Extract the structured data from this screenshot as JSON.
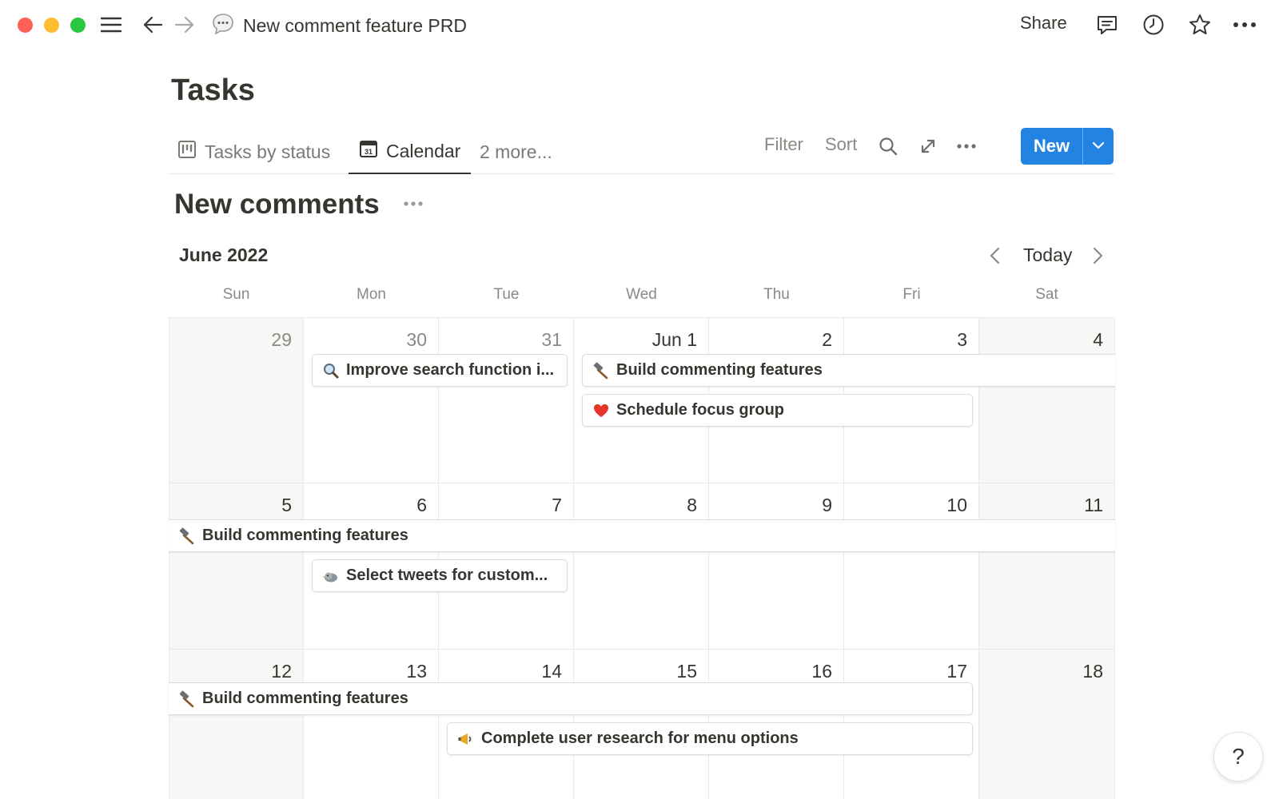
{
  "topbar": {
    "breadcrumb_title": "New comment feature PRD",
    "breadcrumb_icon": "speech-bubble-icon",
    "share_label": "Share"
  },
  "page": {
    "title": "Tasks"
  },
  "views": {
    "tabs": [
      {
        "label": "Tasks by status",
        "icon": "board-icon",
        "active": false
      },
      {
        "label": "Calendar",
        "icon": "calendar-icon",
        "active": true
      },
      {
        "label": "2 more...",
        "active": false
      }
    ],
    "filter_label": "Filter",
    "sort_label": "Sort",
    "new_label": "New"
  },
  "view_title": "New comments",
  "calendar": {
    "month_label": "June 2022",
    "today_label": "Today",
    "weekdays": [
      "Sun",
      "Mon",
      "Tue",
      "Wed",
      "Thu",
      "Fri",
      "Sat"
    ],
    "weeks": [
      [
        "29",
        "30",
        "31",
        "Jun 1",
        "2",
        "3",
        "4"
      ],
      [
        "5",
        "6",
        "7",
        "8",
        "9",
        "10",
        "11"
      ],
      [
        "12",
        "13",
        "14",
        "15",
        "16",
        "17",
        "18"
      ]
    ],
    "events": [
      {
        "label": "Improve search function i...",
        "icon": "magnifying-glass-icon"
      },
      {
        "label": "Build commenting features",
        "icon": "hammer-icon"
      },
      {
        "label": "Schedule focus group",
        "icon": "heart-icon"
      },
      {
        "label": "Build commenting features",
        "icon": "hammer-icon"
      },
      {
        "label": "Select tweets for custom...",
        "icon": "bird-icon"
      },
      {
        "label": "Build commenting features",
        "icon": "hammer-icon"
      },
      {
        "label": "Complete user research for menu options",
        "icon": "megaphone-icon"
      }
    ]
  },
  "colors": {
    "accent": "#2383e2",
    "text": "#37352f",
    "muted": "#8a8984",
    "weekend_bg": "#f7f7f5"
  },
  "help_label": "?"
}
